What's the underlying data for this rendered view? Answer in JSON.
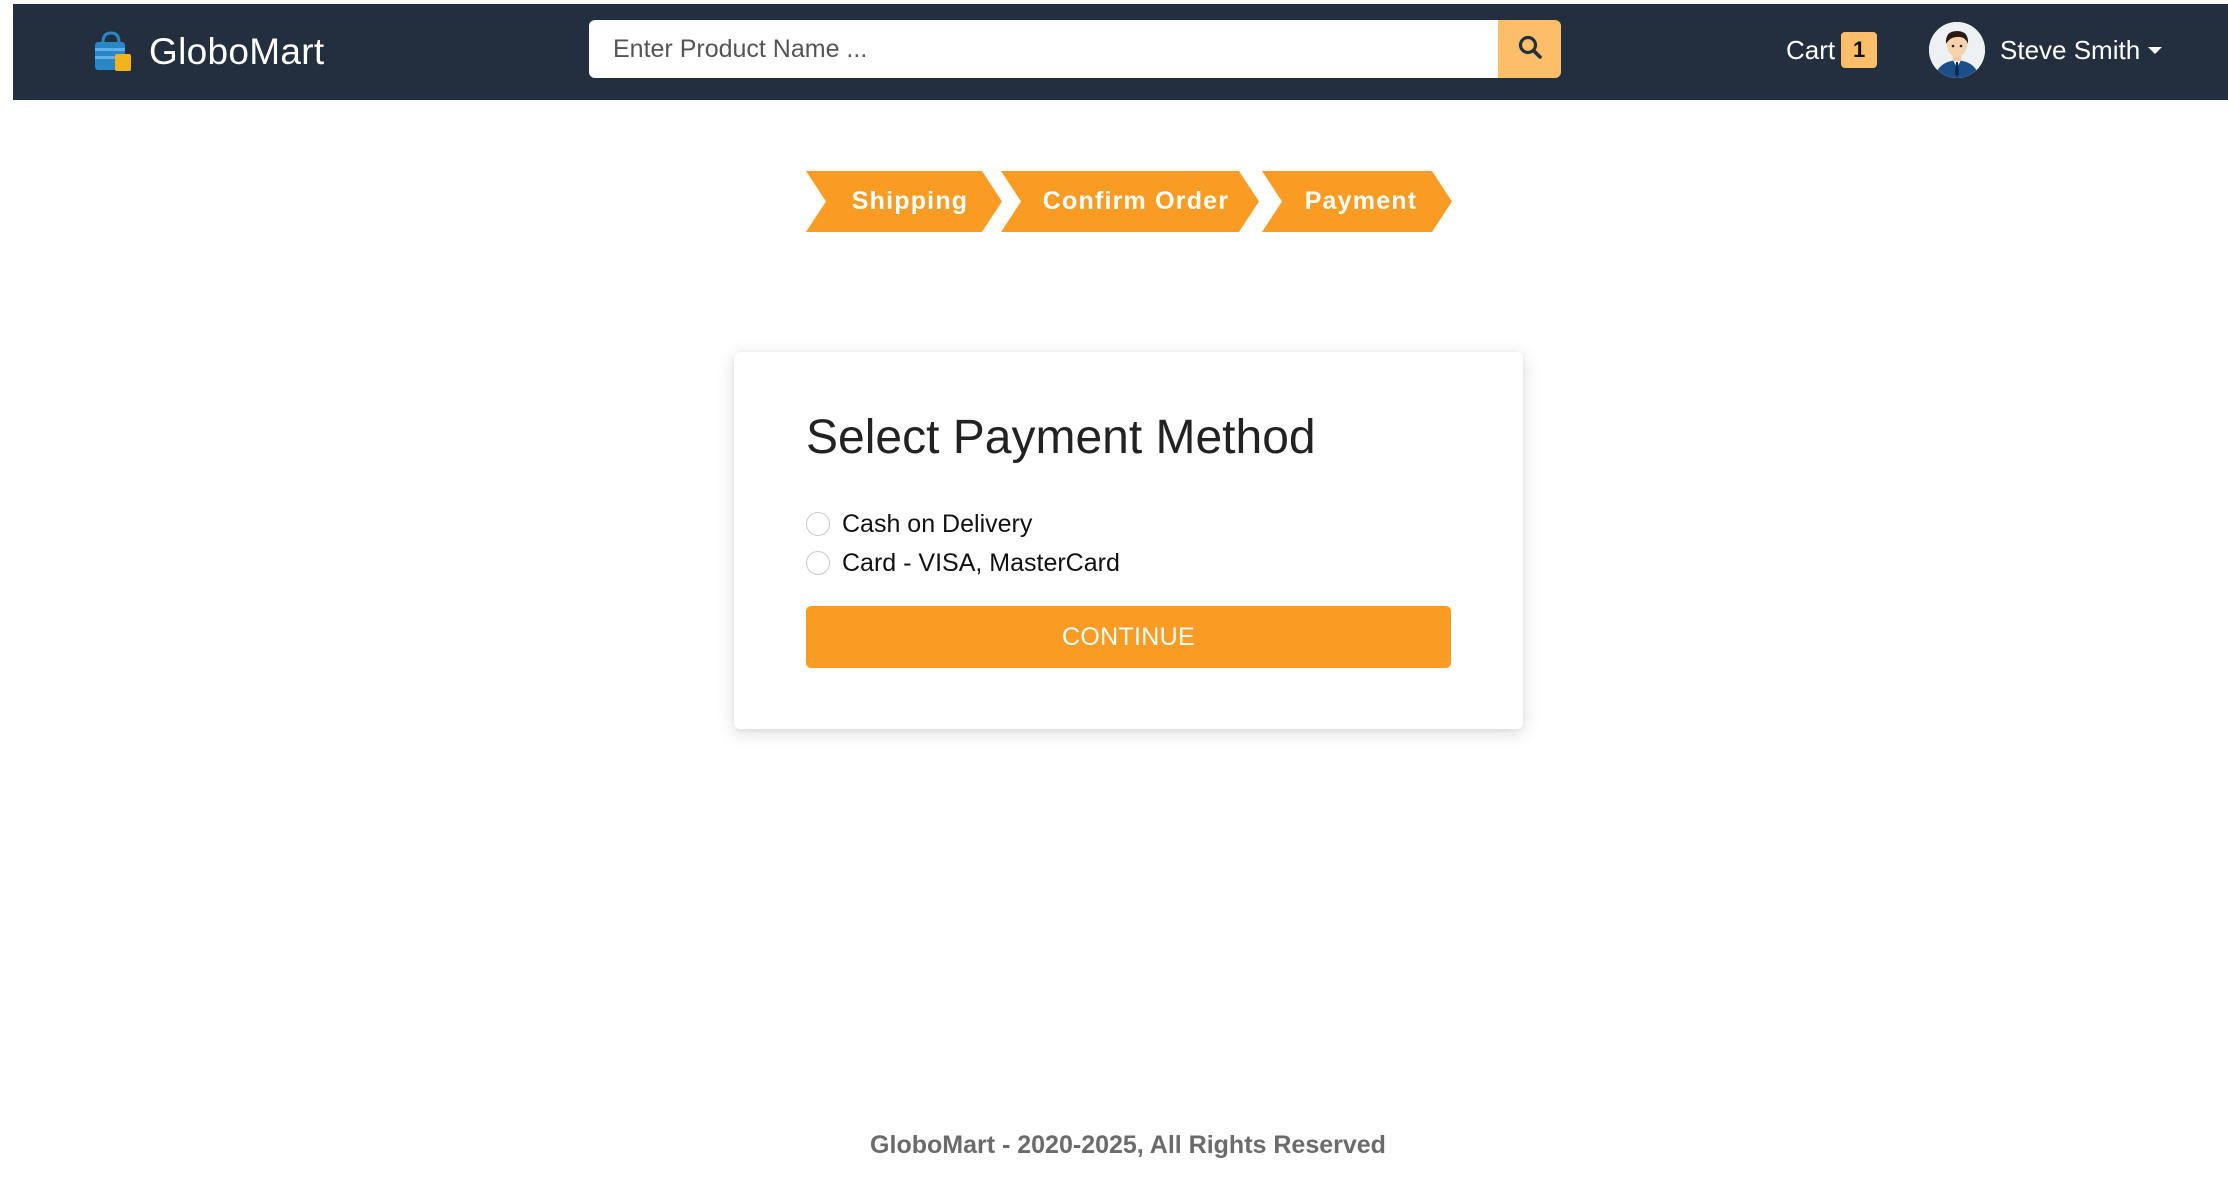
{
  "header": {
    "brand": "GloboMart",
    "search_placeholder": "Enter Product Name ...",
    "cart_label": "Cart",
    "cart_count": "1",
    "user_name": "Steve Smith"
  },
  "steps": [
    {
      "label": "Shipping"
    },
    {
      "label": "Confirm Order"
    },
    {
      "label": "Payment"
    }
  ],
  "payment": {
    "title": "Select Payment Method",
    "options": [
      {
        "label": "Cash on Delivery"
      },
      {
        "label": "Card - VISA, MasterCard"
      }
    ],
    "continue_label": "CONTINUE"
  },
  "footer": {
    "text": "GloboMart - 2020-2025, All Rights Reserved"
  },
  "colors": {
    "navbar": "#232f3e",
    "accent": "#febd69",
    "step": "#fa9c23",
    "button": "#fa9c23"
  }
}
